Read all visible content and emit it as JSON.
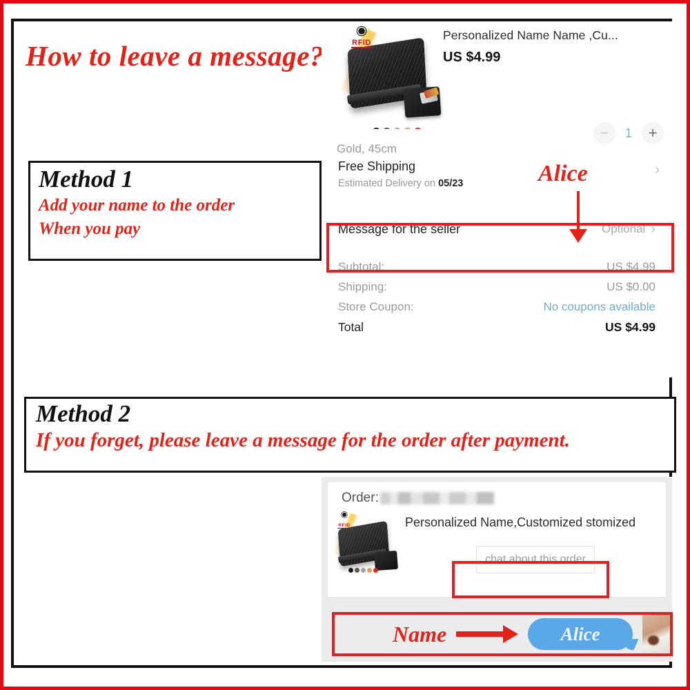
{
  "promo": {
    "title": "How to leave a message?",
    "method1": {
      "heading": "Method 1",
      "line1": "Add your name to the order",
      "line2": "When you pay"
    },
    "method2": {
      "heading": "Method 2",
      "line1": "If you forget, please leave a message for the order after payment."
    },
    "alice_annotation": "Alice",
    "name_annotation": "Name"
  },
  "checkout": {
    "product": {
      "title": "Personalized Name  Name     ,Cu...",
      "price": "US $4.99",
      "variant": "Gold, 45cm",
      "rfid_badge": "RFID",
      "swatches": [
        "#1a1a1a",
        "#6b4f46",
        "#9aa3ad",
        "#d4a055",
        "#e0261c"
      ]
    },
    "quantity": {
      "minus": "−",
      "value": "1",
      "plus": "+"
    },
    "shipping": {
      "title": "Free Shipping",
      "estimate_prefix": "Estimated Delivery on ",
      "estimate_date": "05/23",
      "chevron": "›"
    },
    "message_row": {
      "label": "Message for the seller",
      "value": "Optional",
      "chevron": "›"
    },
    "totals": [
      {
        "label": "Subtotal:",
        "value": "US $4.99",
        "kind": "normal"
      },
      {
        "label": "Shipping:",
        "value": "US $0.00",
        "kind": "normal"
      },
      {
        "label": "Store Coupon:",
        "value": "No coupons available",
        "kind": "coupon"
      },
      {
        "label": "Total",
        "value": "US $4.99",
        "kind": "total"
      }
    ]
  },
  "order_card": {
    "order_label": "Order:",
    "order_number_masked": "",
    "title": "Personalized Name,Customized stomized",
    "chat_button": "chat about this order",
    "swatches": [
      "#1a1a1a",
      "#6b4f46",
      "#9aa3ad",
      "#d4a055",
      "#e0261c"
    ]
  },
  "chat": {
    "message": "Alice"
  },
  "colors": {
    "accent_red": "#e2231a",
    "highlight_red": "#e41f1f",
    "bubble_blue": "#5aa7e8",
    "link_teal": "#6ab0c4",
    "muted_gray": "#9a9a9a"
  }
}
